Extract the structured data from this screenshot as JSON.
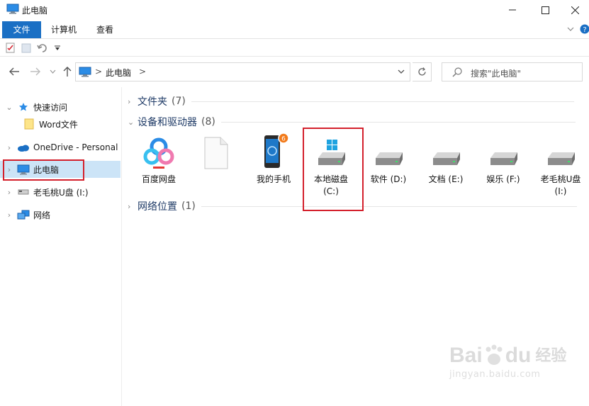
{
  "window": {
    "title": "此电脑"
  },
  "ribbon": {
    "tabs": [
      "文件",
      "计算机",
      "查看"
    ]
  },
  "address": {
    "crumb_root_sep": ">",
    "crumb": "此电脑",
    "crumb_sep": ">"
  },
  "search": {
    "placeholder": "搜索\"此电脑\""
  },
  "nav": {
    "items": [
      {
        "label": "快速访问"
      },
      {
        "label": "Word文件"
      },
      {
        "label": "OneDrive - Personal"
      },
      {
        "label": "此电脑"
      },
      {
        "label": "老毛桃U盘 (I:)"
      },
      {
        "label": "网络"
      }
    ]
  },
  "groups": {
    "folders": {
      "title": "文件夹",
      "count": "(7)"
    },
    "devices": {
      "title": "设备和驱动器",
      "count": "(8)"
    },
    "network": {
      "title": "网络位置",
      "count": "(1)"
    }
  },
  "devices": [
    {
      "label": "百度网盘",
      "icon": "baidu-netdisk-icon"
    },
    {
      "label": "",
      "icon": "blank-file-icon"
    },
    {
      "label": "我的手机",
      "icon": "phone-icon",
      "badge": "6"
    },
    {
      "label": "本地磁盘\n(C:)",
      "icon": "windows-drive-icon"
    },
    {
      "label": "软件 (D:)",
      "icon": "drive-icon"
    },
    {
      "label": "文档 (E:)",
      "icon": "drive-icon"
    },
    {
      "label": "娱乐 (F:)",
      "icon": "drive-icon"
    },
    {
      "label": "老毛桃U盘\n(I:)",
      "icon": "drive-icon"
    }
  ],
  "watermark": {
    "brand": "Bai",
    "brand2": "du",
    "cn": "经验",
    "url": "jingyan.baidu.com"
  },
  "colors": {
    "accent": "#1a6fc4",
    "selection": "#cce4f7",
    "highlight_box": "#d4202c"
  }
}
